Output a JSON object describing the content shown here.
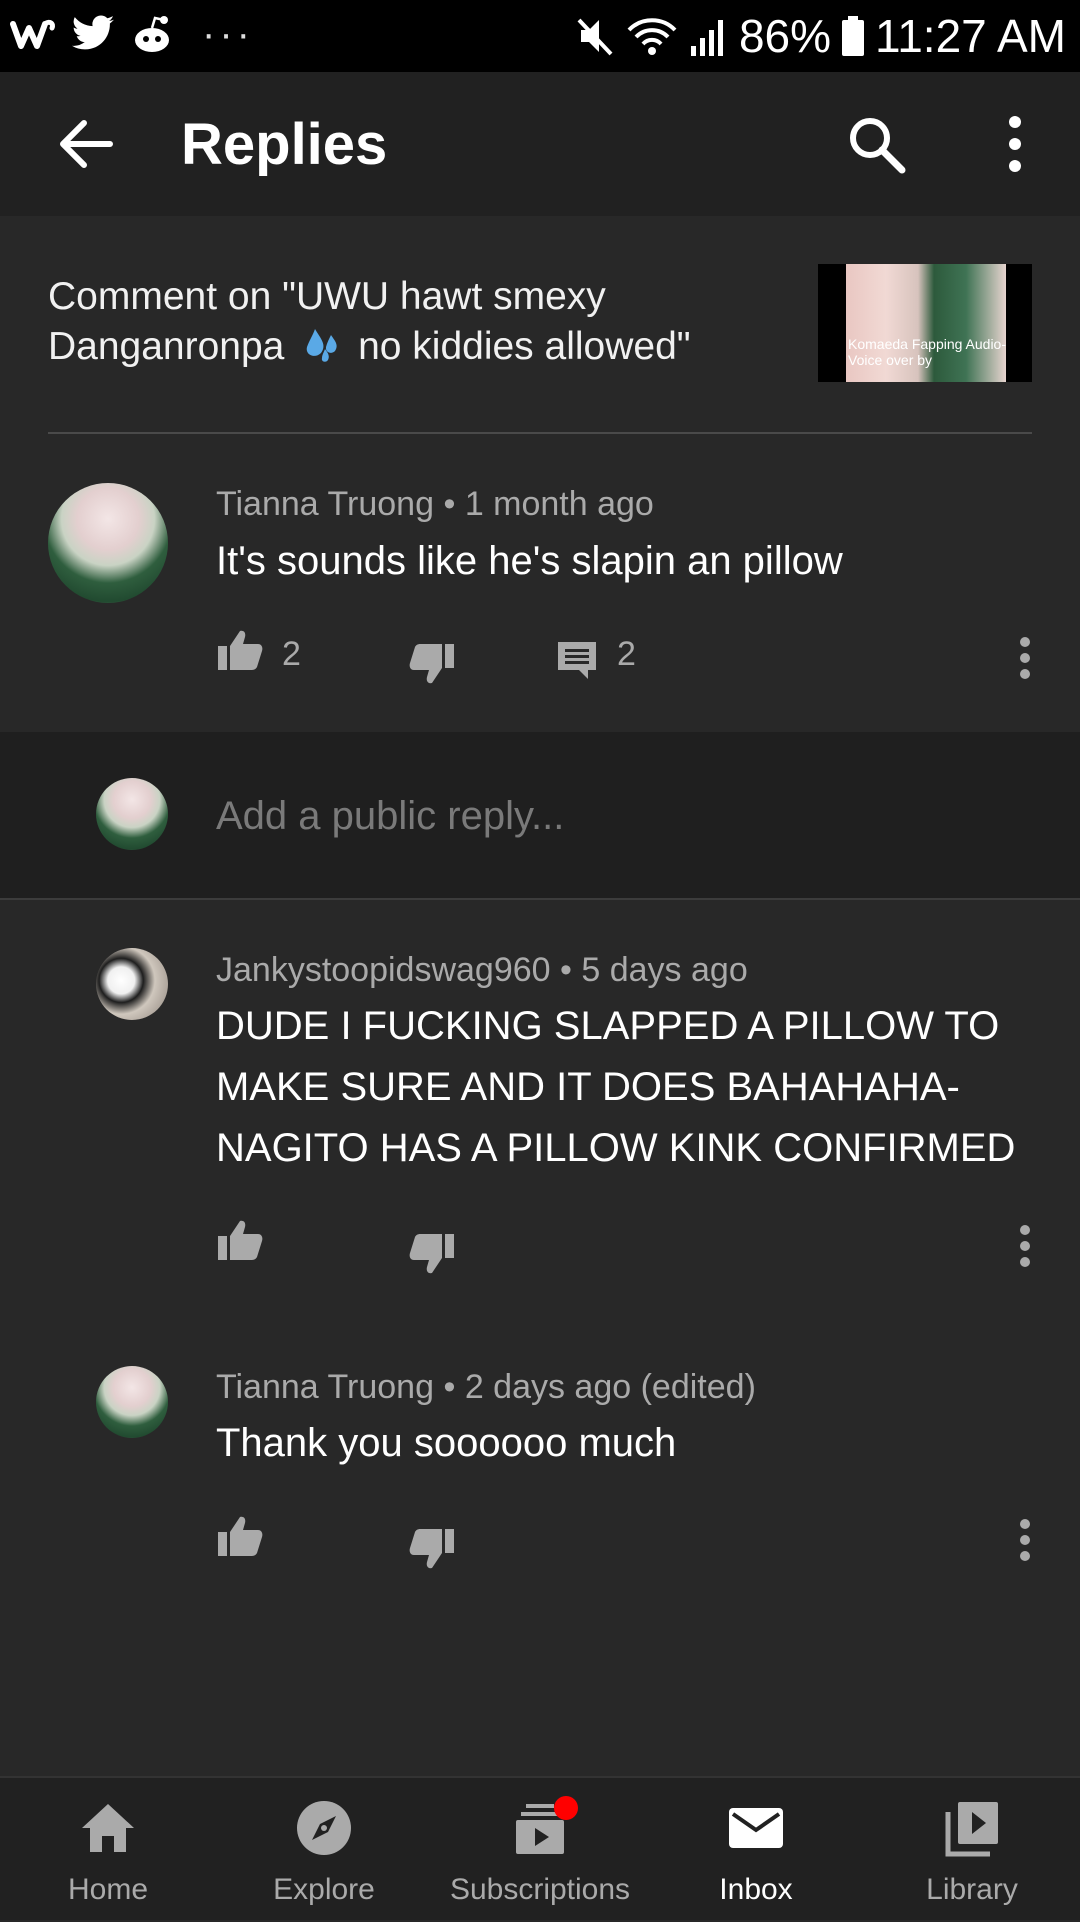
{
  "status_bar": {
    "left_icons": [
      "wish-icon",
      "twitter-icon",
      "reddit-icon"
    ],
    "more_indicator": "···",
    "battery": "86%",
    "time": "11:27 AM"
  },
  "app_bar": {
    "title": "Replies"
  },
  "header": {
    "prefix": "Comment on \"UWU hawt smexy Danganronpa",
    "suffix": "no kiddies allowed\"",
    "emoji": "💦",
    "thumbnail_caption": "Komaeda Fapping Audio- Voice over by"
  },
  "comment": {
    "author": "Tianna Truong",
    "separator": "•",
    "time": "1 month ago",
    "text": "It's sounds like he's slapin an pillow",
    "likes": "2",
    "replies": "2"
  },
  "reply_input": {
    "placeholder": "Add a public reply..."
  },
  "replies": [
    {
      "author": "Jankystoopidswag960",
      "separator": "•",
      "time": "5 days ago",
      "text": "DUDE I FUCKING SLAPPED A PILLOW TO MAKE SURE AND IT DOES BAHAHAHA- NAGITO HAS A PILLOW KINK CONFIRMED"
    },
    {
      "author": "Tianna Truong",
      "separator": "•",
      "time": "2 days ago (edited)",
      "text": "Thank you soooooo much"
    }
  ],
  "bottom_nav": {
    "items": [
      {
        "label": "Home",
        "icon": "home-icon"
      },
      {
        "label": "Explore",
        "icon": "compass-icon"
      },
      {
        "label": "Subscriptions",
        "icon": "subscriptions-icon"
      },
      {
        "label": "Inbox",
        "icon": "inbox-icon"
      },
      {
        "label": "Library",
        "icon": "library-icon"
      }
    ],
    "active": "Inbox"
  },
  "colors": {
    "background": "#282828",
    "app_bar": "#212121",
    "secondary_text": "#aaaaaa",
    "badge": "#ff0000"
  }
}
